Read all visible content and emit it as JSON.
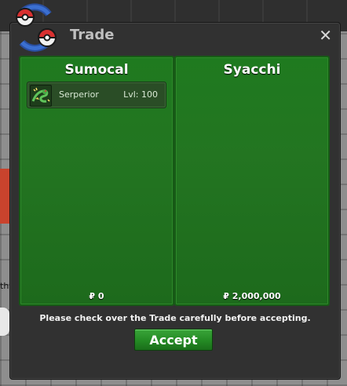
{
  "window": {
    "title": "Trade",
    "close_glyph": "✕"
  },
  "left_panel": {
    "player_name": "Sumocal",
    "money": "₽ 0",
    "pokemon": [
      {
        "name": "Serperior",
        "level": "Lvl: 100",
        "icon": "serperior-icon"
      }
    ]
  },
  "right_panel": {
    "player_name": "Syacchi",
    "money": "₽ 2,000,000",
    "pokemon": []
  },
  "notice": "Please check over the Trade carefully before accepting.",
  "accept_label": "Accept",
  "background": {
    "left_edge_text": "th"
  },
  "colors": {
    "panel_green": "#237521",
    "button_green": "#248a24",
    "window_bg": "#313131"
  }
}
